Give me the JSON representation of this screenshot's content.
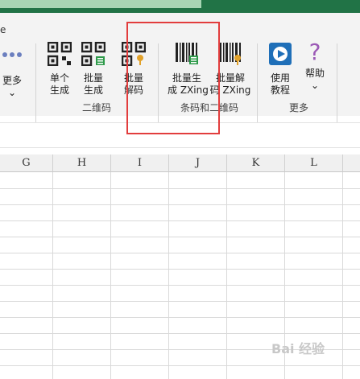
{
  "ribbon": {
    "clip_letter": "e",
    "more_btn": "更多",
    "btn_single_gen": [
      "单个",
      "生成"
    ],
    "btn_batch_gen": [
      "批量",
      "生成"
    ],
    "btn_batch_decode": [
      "批量",
      "解码"
    ],
    "btn_batch_gen_zxing": [
      "批量生",
      "成 ZXing"
    ],
    "btn_batch_decode_zxing": [
      "批量解",
      "码 ZXing"
    ],
    "btn_tutorial": [
      "使用",
      "教程"
    ],
    "btn_help": "帮助",
    "group_qr": "二维码",
    "group_barcode": "条码和二维码",
    "group_more": "更多"
  },
  "columns": [
    "G",
    "H",
    "I",
    "J",
    "K",
    "L"
  ],
  "colors": {
    "title_bar": "#217346",
    "highlight": "#e23d3d"
  },
  "watermark": "Bai 经验"
}
